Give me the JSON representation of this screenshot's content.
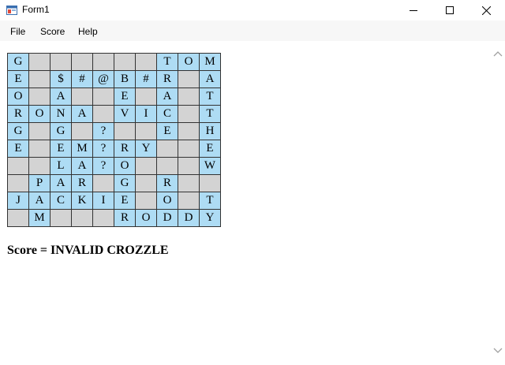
{
  "window": {
    "title": "Form1"
  },
  "menu": [
    "File",
    "Score",
    "Help"
  ],
  "grid": {
    "rows": [
      [
        "G",
        "",
        "",
        "",
        "",
        "",
        "",
        "T",
        "O",
        "M"
      ],
      [
        "E",
        "",
        "$",
        "#",
        "@",
        "B",
        "#",
        "R",
        "",
        "A"
      ],
      [
        "O",
        "",
        "A",
        "",
        "",
        "E",
        "",
        "A",
        "",
        "T"
      ],
      [
        "R",
        "O",
        "N",
        "A",
        "",
        "V",
        "I",
        "C",
        "",
        "T"
      ],
      [
        "G",
        "",
        "G",
        "",
        "?",
        "",
        "",
        "E",
        "",
        "H"
      ],
      [
        "E",
        "",
        "E",
        "M",
        "?",
        "R",
        "Y",
        "",
        "",
        "E"
      ],
      [
        "",
        "",
        "L",
        "A",
        "?",
        "O",
        "",
        "",
        "",
        "W"
      ],
      [
        "",
        "P",
        "A",
        "R",
        "",
        "G",
        "",
        "R",
        "",
        ""
      ],
      [
        "J",
        "A",
        "C",
        "K",
        "I",
        "E",
        "",
        "O",
        "",
        "T"
      ],
      [
        "",
        "M",
        "",
        "",
        "",
        "R",
        "O",
        "D",
        "D",
        "Y"
      ]
    ],
    "colors": {
      "letter": "#aedcf4",
      "empty": "#d3d3d3"
    }
  },
  "score_text": "Score = INVALID CROZZLE"
}
